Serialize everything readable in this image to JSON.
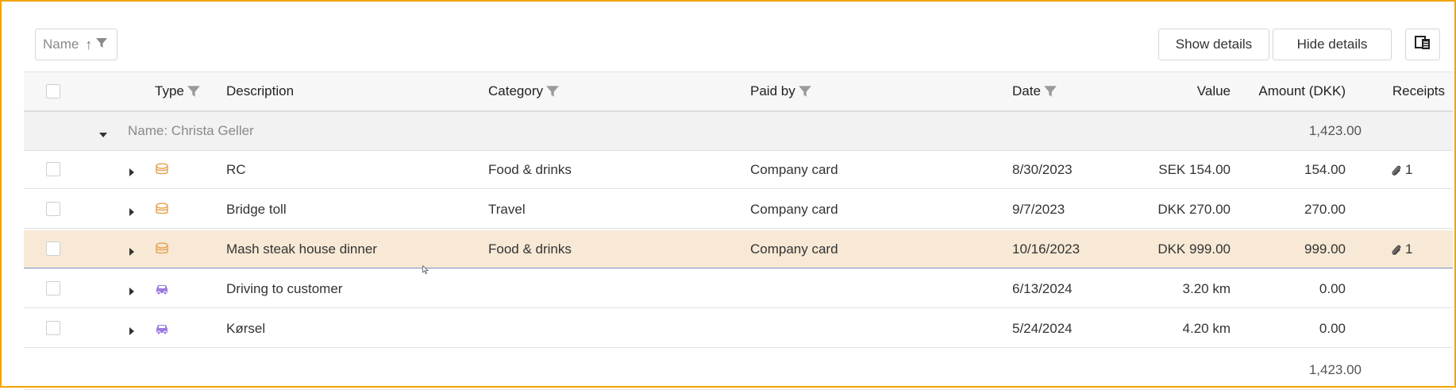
{
  "toolbar": {
    "group_chip_label": "Name",
    "show_details": "Show details",
    "hide_details": "Hide details"
  },
  "columns": {
    "type": "Type",
    "description": "Description",
    "category": "Category",
    "paid_by": "Paid by",
    "date": "Date",
    "value": "Value",
    "amount": "Amount (DKK)",
    "receipts": "Receipts"
  },
  "group": {
    "label": "Name: Christa Geller",
    "total": "1,423.00"
  },
  "rows": [
    {
      "type_icon": "coins-icon",
      "description": "RC",
      "category": "Food & drinks",
      "paid_by": "Company card",
      "date": "8/30/2023",
      "value": "SEK 154.00",
      "amount": "154.00",
      "receipts": "1"
    },
    {
      "type_icon": "coins-icon",
      "description": "Bridge toll",
      "category": "Travel",
      "paid_by": "Company card",
      "date": "9/7/2023",
      "value": "DKK 270.00",
      "amount": "270.00",
      "receipts": ""
    },
    {
      "type_icon": "coins-icon",
      "description": "Mash steak house dinner",
      "category": "Food & drinks",
      "paid_by": "Company card",
      "date": "10/16/2023",
      "value": "DKK 999.00",
      "amount": "999.00",
      "receipts": "1"
    },
    {
      "type_icon": "car-icon",
      "description": "Driving to customer",
      "category": "",
      "paid_by": "",
      "date": "6/13/2024",
      "value": "3.20 km",
      "amount": "0.00",
      "receipts": ""
    },
    {
      "type_icon": "car-icon",
      "description": "Kørsel",
      "category": "",
      "paid_by": "",
      "date": "5/24/2024",
      "value": "4.20 km",
      "amount": "0.00",
      "receipts": ""
    }
  ],
  "footer": {
    "total": "1,423.00"
  },
  "colors": {
    "frame_border": "#f0a500",
    "selected_row": "#f7e9d5",
    "coins_icon": "#e8a85c",
    "car_icon": "#9b7be0"
  }
}
